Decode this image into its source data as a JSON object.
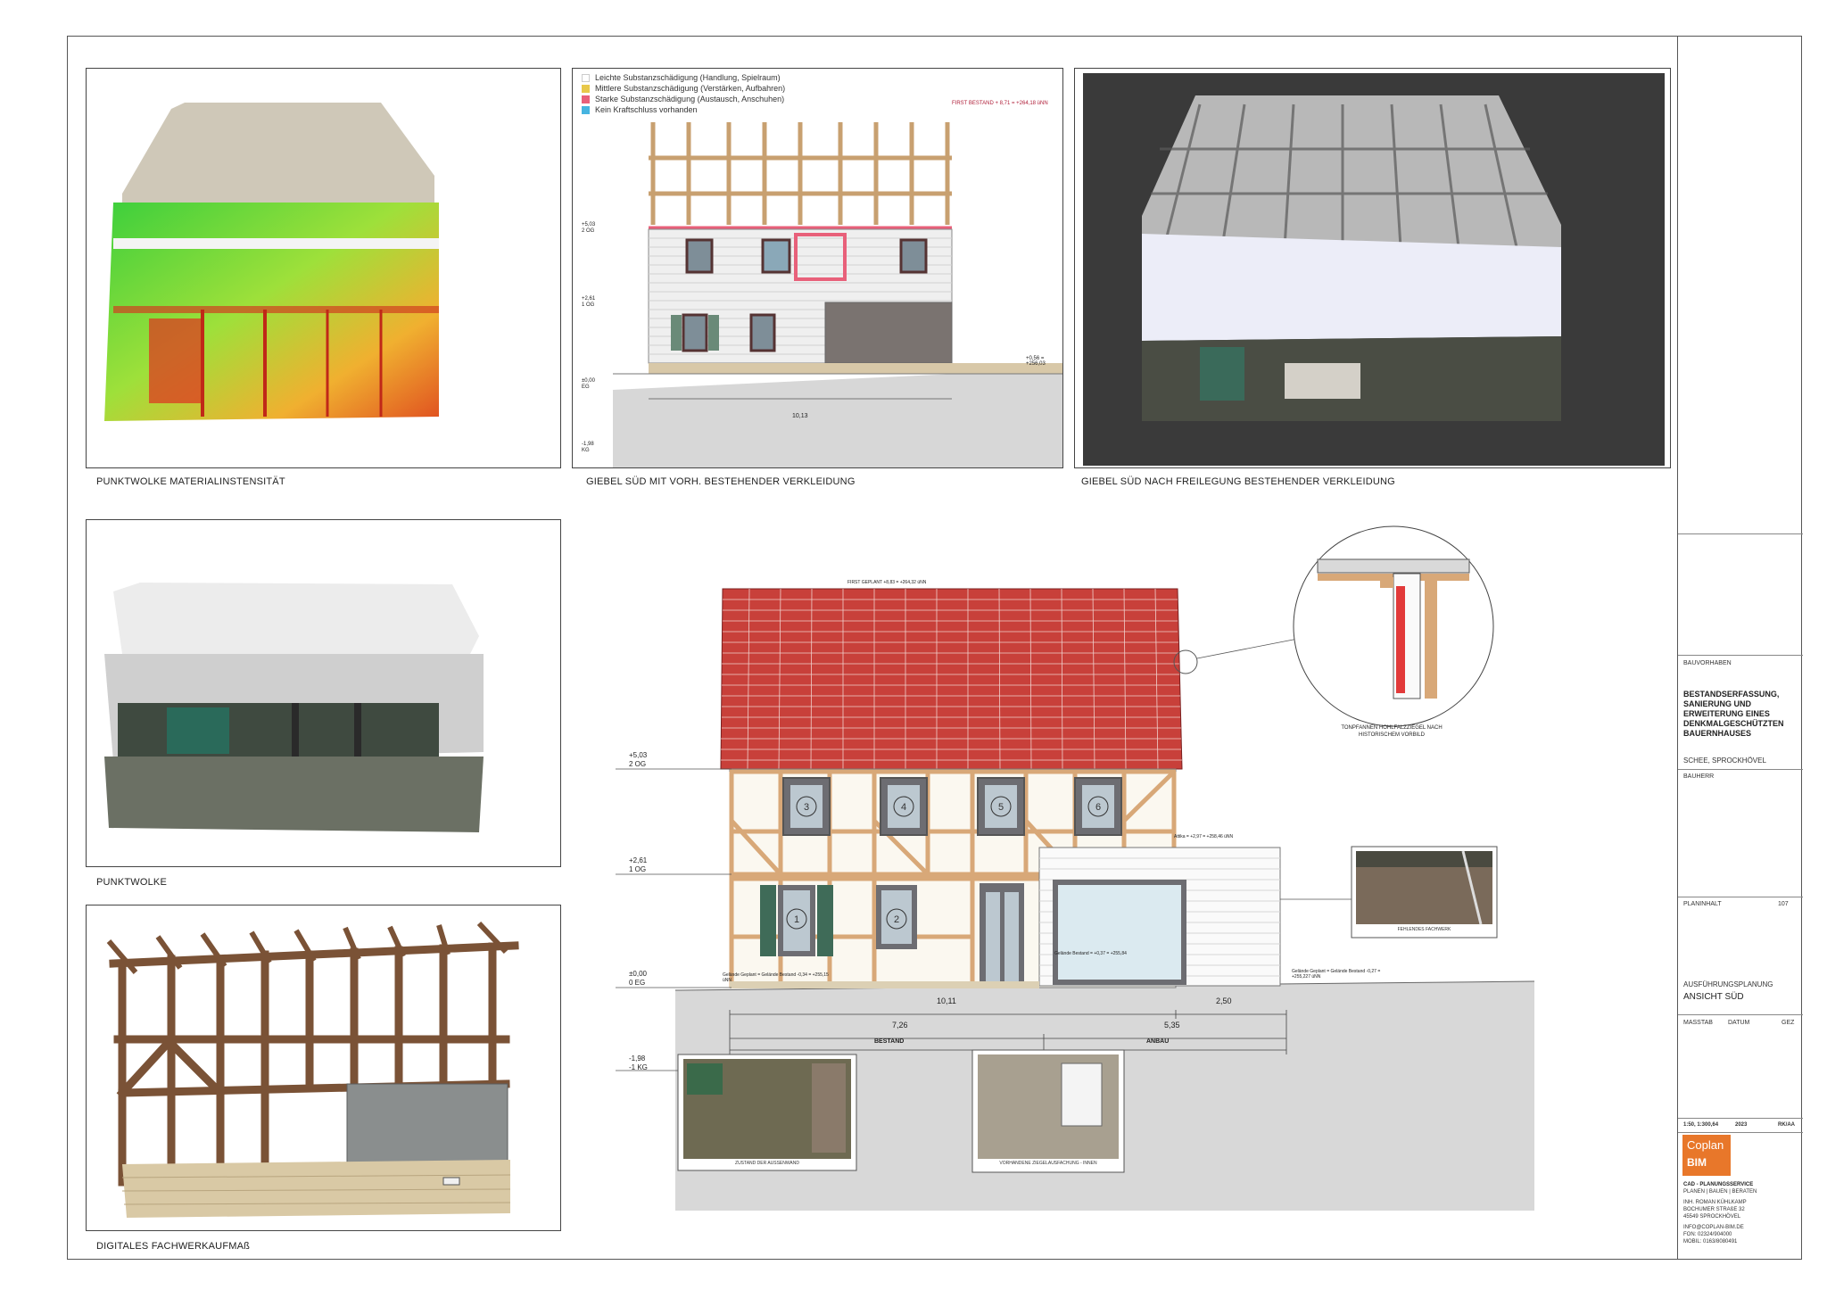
{
  "captions": {
    "top_left": "PUNKTWOLKE MATERIALINSTENSITÄT",
    "top_middle": "GIEBEL SÜD MIT VORH. BESTEHENDER VERKLEIDUNG",
    "top_right": "GIEBEL SÜD NACH FREILEGUNG BESTEHENDER VERKLEIDUNG",
    "mid_left": "PUNKTWOLKE",
    "bottom_left": "DIGITALES FACHWERKAUFMAß"
  },
  "legend": [
    {
      "label": "Leichte Substanzschädigung (Handlung, Spielraum)",
      "color": "#ffffff"
    },
    {
      "label": "Mittlere Substanzschädigung (Verstärken, Aufbahren)",
      "color": "#e8c84a"
    },
    {
      "label": "Starke Substanzschädigung (Austausch, Anschuhen)",
      "color": "#e8607a"
    },
    {
      "label": "Kein Kraftschluss vorhanden",
      "color": "#46b4e0"
    }
  ],
  "gable_annotations": {
    "first_bestand": "FIRST BESTAND + 8,71 = +264,18 üNN",
    "level_2og_top": "+5,03",
    "level_2og_label": "2 OG",
    "level_1og_top": "+2,61",
    "level_1og_label": "1 OG",
    "level_eg_top": "±0,00",
    "level_eg_label": "EG",
    "level_kg_top": "-1,98",
    "level_kg_label": "KG",
    "width_dim": "10,13",
    "right_level": "+0,56 = +256,03"
  },
  "elevation": {
    "first_geplant": "FIRST GEPLANT +8,83 = +264,32 üNN",
    "attika": "Attika = +2,97 = +258,46 üNN",
    "levels": [
      {
        "value": "+5,03",
        "label": "2 OG"
      },
      {
        "value": "+2,61",
        "label": "1 OG"
      },
      {
        "value": "±0,00",
        "label": "0 EG"
      },
      {
        "value": "-1,98",
        "label": "-1 KG"
      }
    ],
    "terrain_left": "Gelände Geplant = Gelände Bestand -0,34 = +255,15 üNN",
    "terrain_mid": "Gelände Bestand = +0,37 = +255,84",
    "terrain_right": "Gelände Geplant = Gelände Bestand -0,27 = +255,227 üNN",
    "dim_total": "10,11",
    "dim_right": "2,50",
    "dim_bestand": "7,26",
    "dim_anbau": "5,35",
    "label_bestand": "BESTAND",
    "label_anbau": "ANBAU",
    "window_numbers": [
      "3",
      "4",
      "5",
      "6",
      "1",
      "2"
    ]
  },
  "detail_note": "TONPFANNEN HOHLFALZZIEGEL NACH HISTORISCHEM VORBILD",
  "photo_captions": {
    "fehlendes": "FEHLENDES FACHWERK",
    "aussenwand": "ZUSTAND DER AUSSENWAND",
    "ziegel": "VORHANDENE ZIEGELAUSFACHUNG - INNEN"
  },
  "titleblock": {
    "bauvorhaben_label": "BAUVORHABEN",
    "project": "BESTANDSERFASSUNG, SANIERUNG UND ERWEITERUNG EINES DENKMALGESCHÜTZTEN BAUERNHAUSES",
    "location": "SCHEE, SPROCKHÖVEL",
    "bauherr_label": "BAUHERR",
    "planinhalt_label": "PLANINHALT",
    "plan_number": "107",
    "phase": "AUSFÜHRUNGSPLANUNG",
    "view": "ANSICHT SÜD",
    "massstab_label": "MASSTAB",
    "datum_label": "DATUM",
    "gez_label": "GEZ",
    "massstab": "1:50, 1:300,64",
    "datum": "2023",
    "gez": "RK/AA",
    "logo_text": "Coplan",
    "logo_sub": "BIM",
    "company": "CAD - PLANUNGSSERVICE",
    "tagline": "PLANEN | BAUEN | BERATEN",
    "owner": "INH. ROMAN KÜHLKAMP",
    "street": "BOCHUMER STRAßE 32",
    "city": "45549 SPROCKHÖVEL",
    "email": "INFO@COPLAN-BIM.DE",
    "phone": "FON: 02324/904000",
    "mobile": "MOBIL: 0163/8080491"
  }
}
